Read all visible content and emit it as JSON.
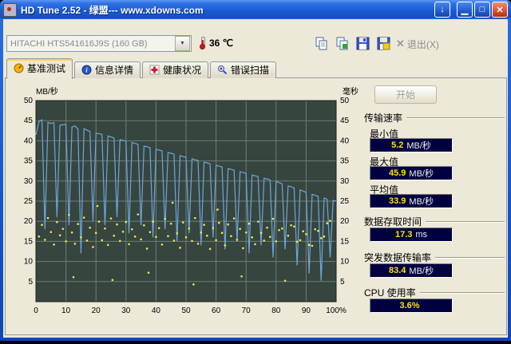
{
  "window": {
    "title": "HD Tune 2.52 - 绿盟--- www.xdowns.com",
    "buttons": {
      "download": "↓",
      "minimize": "▁",
      "maximize": "□",
      "close": "✕"
    }
  },
  "toolbar": {
    "drive_select": "HITACHI HTS541616J9S (160 GB)",
    "dropdown_glyph": "▼",
    "temperature": "36 ℃",
    "exit_glyph": "✕",
    "exit_label": "退出(X)"
  },
  "tabs": [
    {
      "label": "基准测试",
      "icon": "benchmark-icon"
    },
    {
      "label": "信息详情",
      "icon": "info-icon"
    },
    {
      "label": "健康状况",
      "icon": "health-icon"
    },
    {
      "label": "错误扫描",
      "icon": "error-scan-icon"
    }
  ],
  "panel": {
    "start_button": "开始",
    "transfer": {
      "heading": "传输速率",
      "rows": [
        {
          "label": "最小值",
          "value": "5.2",
          "unit": "MB/秒"
        },
        {
          "label": "最大值",
          "value": "45.9",
          "unit": "MB/秒"
        },
        {
          "label": "平均值",
          "value": "33.9",
          "unit": "MB/秒"
        }
      ]
    },
    "sections": [
      {
        "heading": "数据存取时间",
        "value": "17.3",
        "unit": "ms"
      },
      {
        "heading": "突发数据传输率",
        "value": "83.4",
        "unit": "MB/秒"
      },
      {
        "heading": "CPU 使用率",
        "value": "3.6%",
        "unit": ""
      }
    ],
    "value_box_bg": "#000040",
    "value_text_color": "#ffe400"
  },
  "chart_data": {
    "type": "line",
    "title": "",
    "ylabel_left": "MB/秒",
    "ylabel_right": "毫秒",
    "xlim": [
      0,
      100
    ],
    "ylim": [
      0,
      50
    ],
    "x_grid_step": 10,
    "y_grid_step": 5,
    "x_ticks": [
      "0",
      "10",
      "20",
      "30",
      "40",
      "50",
      "60",
      "70",
      "80",
      "90",
      "100%"
    ],
    "y_ticks_left": [
      50,
      45,
      40,
      35,
      30,
      25,
      20,
      15,
      10,
      5
    ],
    "y_ticks_right": [
      50,
      45,
      40,
      35,
      30,
      25,
      20,
      15,
      10,
      5
    ],
    "bg": "#37453f",
    "grid": "#6b7f75",
    "border": "#1c2420",
    "series": [
      {
        "name": "transfer-rate-line",
        "type": "line",
        "color": "#6ca6dd",
        "points": [
          [
            0,
            41.5
          ],
          [
            1,
            44.8
          ],
          [
            2,
            45.2
          ],
          [
            3,
            18
          ],
          [
            4,
            44.6
          ],
          [
            5,
            44.3
          ],
          [
            6,
            44.5
          ],
          [
            7,
            21
          ],
          [
            8,
            43.9
          ],
          [
            10,
            44.1
          ],
          [
            11,
            19
          ],
          [
            12,
            43.4
          ],
          [
            13,
            43.7
          ],
          [
            14,
            42.9
          ],
          [
            15,
            12
          ],
          [
            16,
            43.0
          ],
          [
            18,
            42.3
          ],
          [
            19,
            20
          ],
          [
            20,
            41.9
          ],
          [
            22,
            41.6
          ],
          [
            23,
            19
          ],
          [
            24,
            41.2
          ],
          [
            26,
            40.7
          ],
          [
            27,
            21
          ],
          [
            28,
            40.3
          ],
          [
            30,
            39.9
          ],
          [
            31,
            17
          ],
          [
            32,
            39.6
          ],
          [
            34,
            39.1
          ],
          [
            35,
            19
          ],
          [
            36,
            38.7
          ],
          [
            38,
            38.3
          ],
          [
            39,
            16
          ],
          [
            40,
            37.9
          ],
          [
            42,
            37.5
          ],
          [
            43,
            18
          ],
          [
            44,
            37.1
          ],
          [
            46,
            36.7
          ],
          [
            47,
            15
          ],
          [
            48,
            36.3
          ],
          [
            50,
            35.9
          ],
          [
            51,
            17
          ],
          [
            52,
            35.5
          ],
          [
            54,
            35.1
          ],
          [
            55,
            14
          ],
          [
            56,
            34.7
          ],
          [
            58,
            34.3
          ],
          [
            59,
            16
          ],
          [
            60,
            33.9
          ],
          [
            62,
            33.5
          ],
          [
            63,
            13
          ],
          [
            64,
            33.1
          ],
          [
            66,
            32.7
          ],
          [
            67,
            15
          ],
          [
            68,
            32.3
          ],
          [
            70,
            31.9
          ],
          [
            71,
            12
          ],
          [
            72,
            31.5
          ],
          [
            74,
            31.1
          ],
          [
            75,
            14
          ],
          [
            76,
            30.7
          ],
          [
            78,
            30.3
          ],
          [
            79,
            11
          ],
          [
            80,
            29.9
          ],
          [
            82,
            29.3
          ],
          [
            83,
            13
          ],
          [
            84,
            28.8
          ],
          [
            86,
            28.3
          ],
          [
            87,
            9
          ],
          [
            88,
            27.8
          ],
          [
            90,
            27.2
          ],
          [
            91,
            7
          ],
          [
            92,
            26.7
          ],
          [
            94,
            26.2
          ],
          [
            95,
            5.2
          ],
          [
            96,
            25.8
          ],
          [
            97,
            25.5
          ],
          [
            98,
            11
          ],
          [
            99,
            25.2
          ],
          [
            100,
            25.0
          ]
        ]
      },
      {
        "name": "access-time-scatter",
        "type": "scatter",
        "color": "#f0e64b",
        "points": [
          [
            1,
            16.2
          ],
          [
            2,
            19.1
          ],
          [
            3,
            15.4
          ],
          [
            4,
            20.8
          ],
          [
            5,
            17.3
          ],
          [
            6,
            14.2
          ],
          [
            7,
            19.8
          ],
          [
            8,
            16.5
          ],
          [
            9,
            18.1
          ],
          [
            10,
            15.0
          ],
          [
            11,
            21.6
          ],
          [
            12,
            17.2
          ],
          [
            12.5,
            6.1
          ],
          [
            13,
            14.4
          ],
          [
            14,
            19.3
          ],
          [
            15,
            16.0
          ],
          [
            16,
            20.9
          ],
          [
            17,
            15.2
          ],
          [
            18,
            18.4
          ],
          [
            19,
            13.6
          ],
          [
            20,
            17.1
          ],
          [
            20.5,
            23.8
          ],
          [
            21,
            19.9
          ],
          [
            22,
            15.3
          ],
          [
            23,
            18.2
          ],
          [
            24,
            14.1
          ],
          [
            25,
            20.7
          ],
          [
            25.5,
            5.4
          ],
          [
            26,
            16.4
          ],
          [
            27,
            19.2
          ],
          [
            28,
            15.1
          ],
          [
            29,
            17.4
          ],
          [
            30,
            19.8
          ],
          [
            31,
            14.3
          ],
          [
            32,
            18.0
          ],
          [
            33,
            16.2
          ],
          [
            34,
            21.7
          ],
          [
            35,
            15.5
          ],
          [
            36,
            19.0
          ],
          [
            37,
            13.2
          ],
          [
            37.5,
            7.2
          ],
          [
            38,
            17.3
          ],
          [
            39,
            19.9
          ],
          [
            40,
            16.1
          ],
          [
            41,
            18.3
          ],
          [
            42,
            14.2
          ],
          [
            43,
            20.6
          ],
          [
            44,
            16.3
          ],
          [
            45,
            19.4
          ],
          [
            45.5,
            24.6
          ],
          [
            46,
            15.2
          ],
          [
            47,
            17.0
          ],
          [
            48,
            13.4
          ],
          [
            49,
            19.7
          ],
          [
            50,
            16.0
          ],
          [
            51,
            18.2
          ],
          [
            52,
            15.1
          ],
          [
            52.5,
            4.3
          ],
          [
            53,
            20.8
          ],
          [
            54,
            14.4
          ],
          [
            55,
            17.2
          ],
          [
            56,
            19.1
          ],
          [
            57,
            16.4
          ],
          [
            58,
            13.1
          ],
          [
            59,
            18.3
          ],
          [
            60,
            15.3
          ],
          [
            60.5,
            22.9
          ],
          [
            61,
            19.6
          ],
          [
            62,
            17.1
          ],
          [
            63,
            14.0
          ],
          [
            64,
            19.2
          ],
          [
            65,
            16.3
          ],
          [
            66,
            20.7
          ],
          [
            67,
            15.4
          ],
          [
            68,
            18.1
          ],
          [
            68.5,
            6.3
          ],
          [
            69,
            13.3
          ],
          [
            70,
            17.2
          ],
          [
            71,
            19.4
          ],
          [
            72,
            16.0
          ],
          [
            73,
            14.3
          ],
          [
            74,
            19.9
          ],
          [
            75,
            17.1
          ],
          [
            76,
            15.2
          ],
          [
            77,
            18.4
          ],
          [
            78,
            16.1
          ],
          [
            79,
            20.6
          ],
          [
            80,
            15.0
          ],
          [
            81,
            17.8
          ],
          [
            82,
            18.2
          ],
          [
            83,
            5.2
          ],
          [
            84,
            16.4
          ],
          [
            85,
            19.0
          ],
          [
            86,
            18.7
          ],
          [
            87,
            14.9
          ],
          [
            88,
            15.3
          ],
          [
            89,
            17.5
          ],
          [
            90,
            16.8
          ],
          [
            91,
            14.1
          ],
          [
            92,
            13.9
          ],
          [
            93,
            18.0
          ],
          [
            94,
            17.6
          ],
          [
            95,
            15.8
          ],
          [
            96,
            16.2
          ],
          [
            97,
            19.5
          ],
          [
            98,
            20.1
          ]
        ]
      }
    ]
  }
}
